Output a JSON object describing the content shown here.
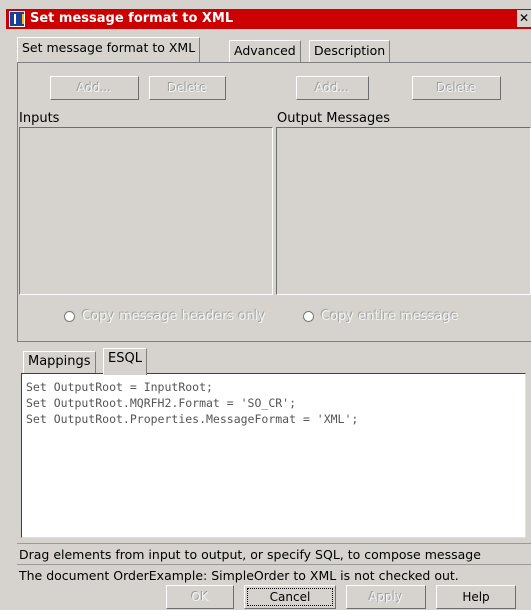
{
  "window": {
    "title": "Set message format to XML",
    "close_symbol": "✕"
  },
  "tabs": [
    {
      "label": "Set message format to XML",
      "active": true
    },
    {
      "label": "Advanced",
      "active": false
    },
    {
      "label": "Description",
      "active": false
    }
  ],
  "inputs": {
    "add_label": "Add...",
    "delete_label": "Delete",
    "section_label": "Inputs",
    "buttons_enabled": false
  },
  "outputs": {
    "add_label": "Add...",
    "delete_label": "Delete",
    "section_label": "Output Messages",
    "buttons_enabled": false
  },
  "copy_options": [
    {
      "label": "Copy message headers only",
      "enabled": false,
      "selected": false
    },
    {
      "label": "Copy entire message",
      "enabled": false,
      "selected": false
    }
  ],
  "subtabs": [
    {
      "label": "Mappings",
      "active": false
    },
    {
      "label": "ESQL",
      "active": true
    }
  ],
  "esql_lines": [
    "Set OutputRoot = InputRoot;",
    "Set OutputRoot.MQRFH2.Format = 'SO_CR';",
    "Set OutputRoot.Properties.MessageFormat = 'XML';"
  ],
  "status": {
    "hint": "Drag elements from input to output, or specify SQL, to compose message",
    "checkout": "The document OrderExample: SimpleOrder to XML is not checked out."
  },
  "footer_buttons": {
    "ok": "OK",
    "cancel": "Cancel",
    "apply": "Apply",
    "help": "Help"
  },
  "colors": {
    "title_bar": "#cc0000",
    "background": "#d6d3ce",
    "editor_bg": "#ffffff"
  }
}
